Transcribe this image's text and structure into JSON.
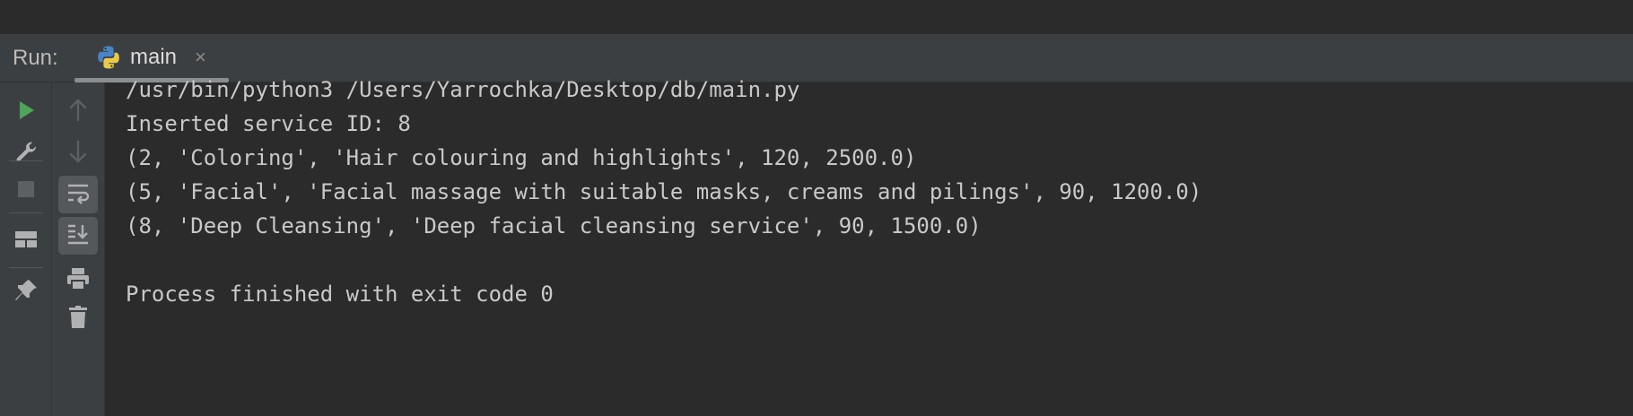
{
  "run_panel": {
    "label": "Run:",
    "tab": {
      "label": "main",
      "close_glyph": "×",
      "icon": "python-icon"
    }
  },
  "toolbar": {
    "left": [
      "run-icon",
      "wrench-icon",
      "stop-icon",
      "layout-icon",
      "pin-icon"
    ],
    "right": [
      "arrow-up-icon",
      "arrow-down-icon",
      "soft-wrap-icon",
      "scroll-to-end-icon",
      "print-icon",
      "trash-icon"
    ]
  },
  "console": {
    "lines": [
      "/usr/bin/python3 /Users/Yarrochka/Desktop/db/main.py",
      "Inserted service ID: 8",
      "(2, 'Coloring', 'Hair colouring and highlights', 120, 2500.0)",
      "(5, 'Facial', 'Facial massage with suitable masks, creams and pilings', 90, 1200.0)",
      "(8, 'Deep Cleansing', 'Deep facial cleansing service', 90, 1500.0)",
      "",
      "Process finished with exit code 0"
    ]
  },
  "colors": {
    "run_green": "#4fa35a",
    "icon_gray": "#afb1b3",
    "icon_disabled": "#5d6063",
    "panel_bg": "#3c3f41",
    "console_bg": "#2b2b2c",
    "text": "#c9c9c9"
  }
}
